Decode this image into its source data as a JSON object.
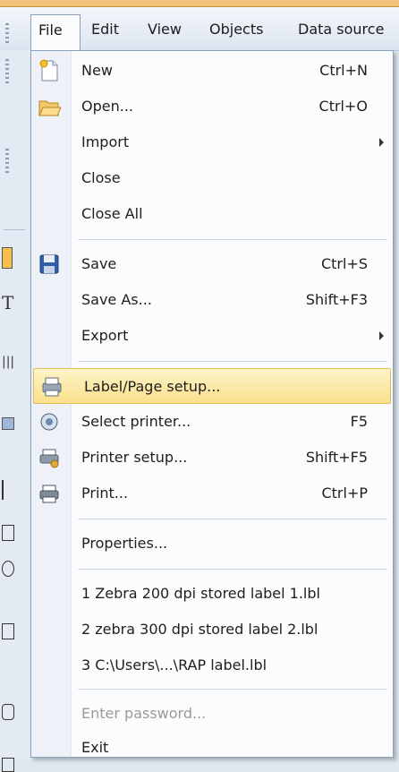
{
  "menubar": {
    "items": [
      "File",
      "Edit",
      "View",
      "Objects",
      "Data source"
    ]
  },
  "file_menu": {
    "items": [
      {
        "label": "New",
        "shortcut": "Ctrl+N",
        "icon": "new-file-icon"
      },
      {
        "label": "Open...",
        "shortcut": "Ctrl+O",
        "icon": "open-folder-icon"
      },
      {
        "label": "Import",
        "shortcut": "",
        "submenu": true
      },
      {
        "label": "Close",
        "shortcut": ""
      },
      {
        "label": "Close All",
        "shortcut": ""
      },
      {
        "label": "Save",
        "shortcut": "Ctrl+S",
        "icon": "save-floppy-icon"
      },
      {
        "label": "Save As...",
        "shortcut": "Shift+F3"
      },
      {
        "label": "Export",
        "shortcut": "",
        "submenu": true
      },
      {
        "label": "Label/Page setup...",
        "shortcut": "",
        "icon": "page-setup-icon",
        "highlighted": true
      },
      {
        "label": "Select printer...",
        "shortcut": "F5",
        "icon": "select-printer-icon"
      },
      {
        "label": "Printer setup...",
        "shortcut": "Shift+F5",
        "icon": "printer-setup-icon"
      },
      {
        "label": "Print...",
        "shortcut": "Ctrl+P",
        "icon": "print-icon"
      },
      {
        "label": "Properties...",
        "shortcut": ""
      },
      {
        "label": "1 Zebra 200 dpi stored label 1.lbl",
        "shortcut": ""
      },
      {
        "label": "2 zebra 300 dpi stored label 2.lbl",
        "shortcut": ""
      },
      {
        "label": "3 C:\\Users\\...\\RAP label.lbl",
        "shortcut": ""
      },
      {
        "label": "Enter password...",
        "shortcut": "",
        "disabled": true
      },
      {
        "label": "Exit",
        "shortcut": ""
      }
    ]
  },
  "colors": {
    "highlight": "#fbe08b",
    "menu_border": "#8aa0bf",
    "disabled_text": "#9a9a9a"
  }
}
